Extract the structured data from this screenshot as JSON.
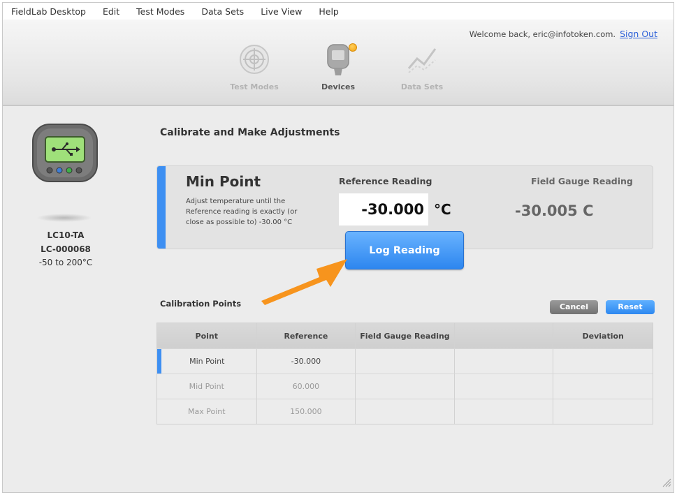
{
  "menu": [
    "FieldLab Desktop",
    "Edit",
    "Test Modes",
    "Data Sets",
    "Live View",
    "Help"
  ],
  "header": {
    "welcome_text": "Welcome back, eric@infotoken.com.",
    "sign_out": "Sign Out",
    "tabs": [
      {
        "label": "Test Modes",
        "icon": "target-icon",
        "state": "inactive"
      },
      {
        "label": "Devices",
        "icon": "gauge-device-icon",
        "state": "active",
        "notification": true
      },
      {
        "label": "Data Sets",
        "icon": "line-graph-icon",
        "state": "inactive"
      }
    ]
  },
  "device": {
    "icon": "usb-device-icon",
    "model": "LC10-TA",
    "serial": "LC-000068",
    "range": "-50 to 200°C"
  },
  "main": {
    "title": "Calibrate and Make Adjustments",
    "point_panel": {
      "title": "Min Point",
      "instructions": "Adjust temperature until the Reference reading is exactly (or close as possible to) -30.00 °C",
      "reference_label": "Reference Reading",
      "reference_value": "-30.000",
      "reference_unit": "°C",
      "field_gauge_label": "Field Gauge Reading",
      "field_gauge_value": "-30.005 C"
    },
    "log_button": "Log Reading",
    "calibration": {
      "title": "Calibration Points",
      "cancel": "Cancel",
      "reset": "Reset",
      "columns": [
        "Point",
        "Reference",
        "Field Gauge Reading",
        "",
        "Deviation"
      ],
      "rows": [
        {
          "point": "Min Point",
          "reference": "-30.000",
          "field": "",
          "blank": "",
          "deviation": "",
          "state": "active"
        },
        {
          "point": "Mid Point",
          "reference": "60.000",
          "field": "",
          "blank": "",
          "deviation": "",
          "state": "inactive"
        },
        {
          "point": "Max Point",
          "reference": "150.000",
          "field": "",
          "blank": "",
          "deviation": "",
          "state": "inactive"
        }
      ]
    }
  },
  "colors": {
    "accent_blue": "#3d8ff2",
    "notification_orange": "#f3a212",
    "arrow_orange": "#f7941d"
  }
}
